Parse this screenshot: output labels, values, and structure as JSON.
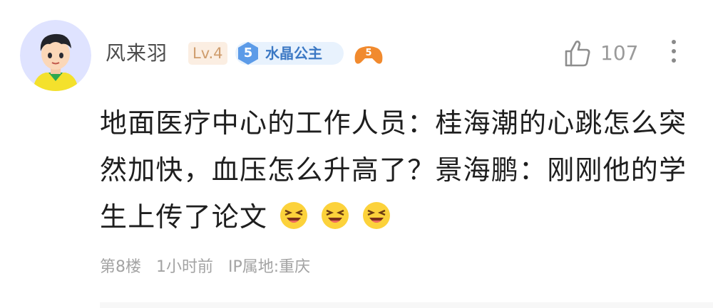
{
  "comment": {
    "username": "风来羽",
    "level_badge": "Lv.4",
    "fan_badge": {
      "level": "5",
      "name": "水晶公主"
    },
    "game_badge_icon": "game-controller-icon",
    "like_count": "107",
    "text": "地面医疗中心的工作人员：桂海潮的心跳怎么突然加快，血压怎么升高了？景海鹏：刚刚他的学生上传了论文",
    "emojis": [
      "laughing-face-icon",
      "laughing-face-icon",
      "laughing-face-icon"
    ],
    "meta": {
      "floor": "第8楼",
      "time": "1小时前",
      "ip": "IP属地:重庆"
    }
  },
  "colors": {
    "level_badge_bg": "#fbeee2",
    "level_badge_text": "#cf9d6d",
    "fan_badge_bg": "#e8f2fd",
    "fan_badge_text": "#3b78c4",
    "meta_text": "#a3a3a3"
  }
}
